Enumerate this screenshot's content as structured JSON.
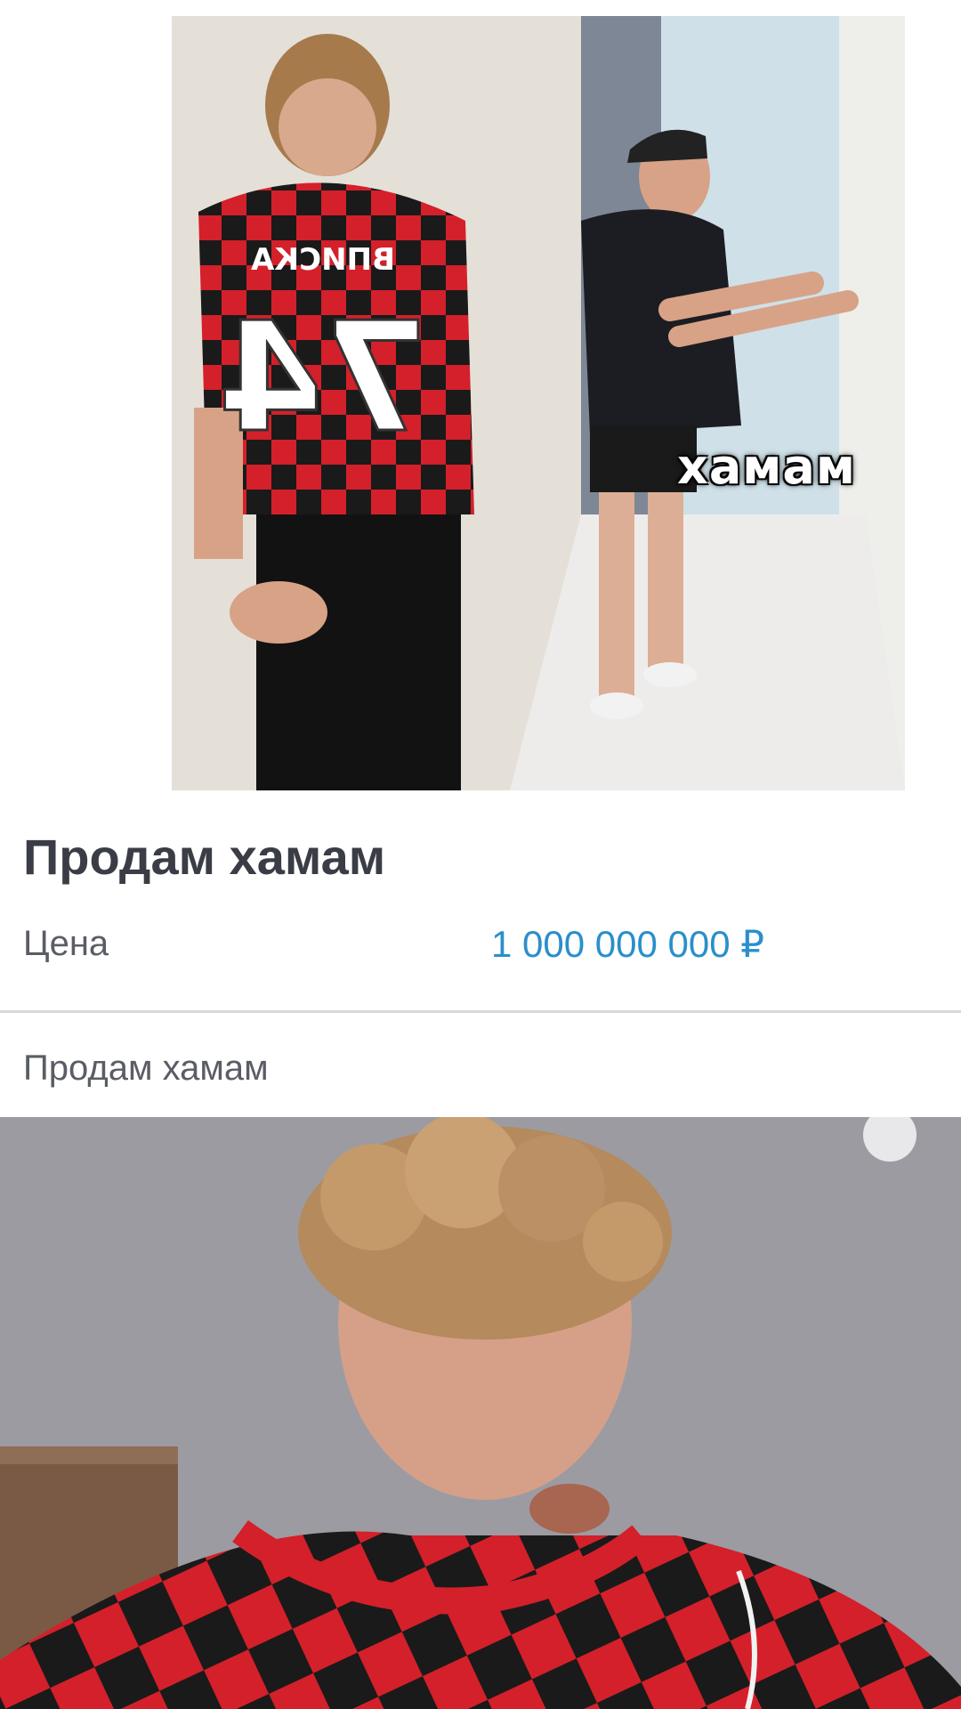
{
  "listing": {
    "title": "Продам хамам",
    "price_label": "Цена",
    "price_value": "1 000 000 000 ₽",
    "description": "Продам хамам",
    "image_caption": "хамам",
    "jersey_text": "ВПИСКА",
    "jersey_number": "74"
  },
  "colors": {
    "title": "#3a3d45",
    "label": "#5a5d65",
    "price": "#2a8fcb",
    "divider": "#d6d8dc",
    "jersey_red": "#d4202a",
    "jersey_black": "#1a1a1a"
  }
}
